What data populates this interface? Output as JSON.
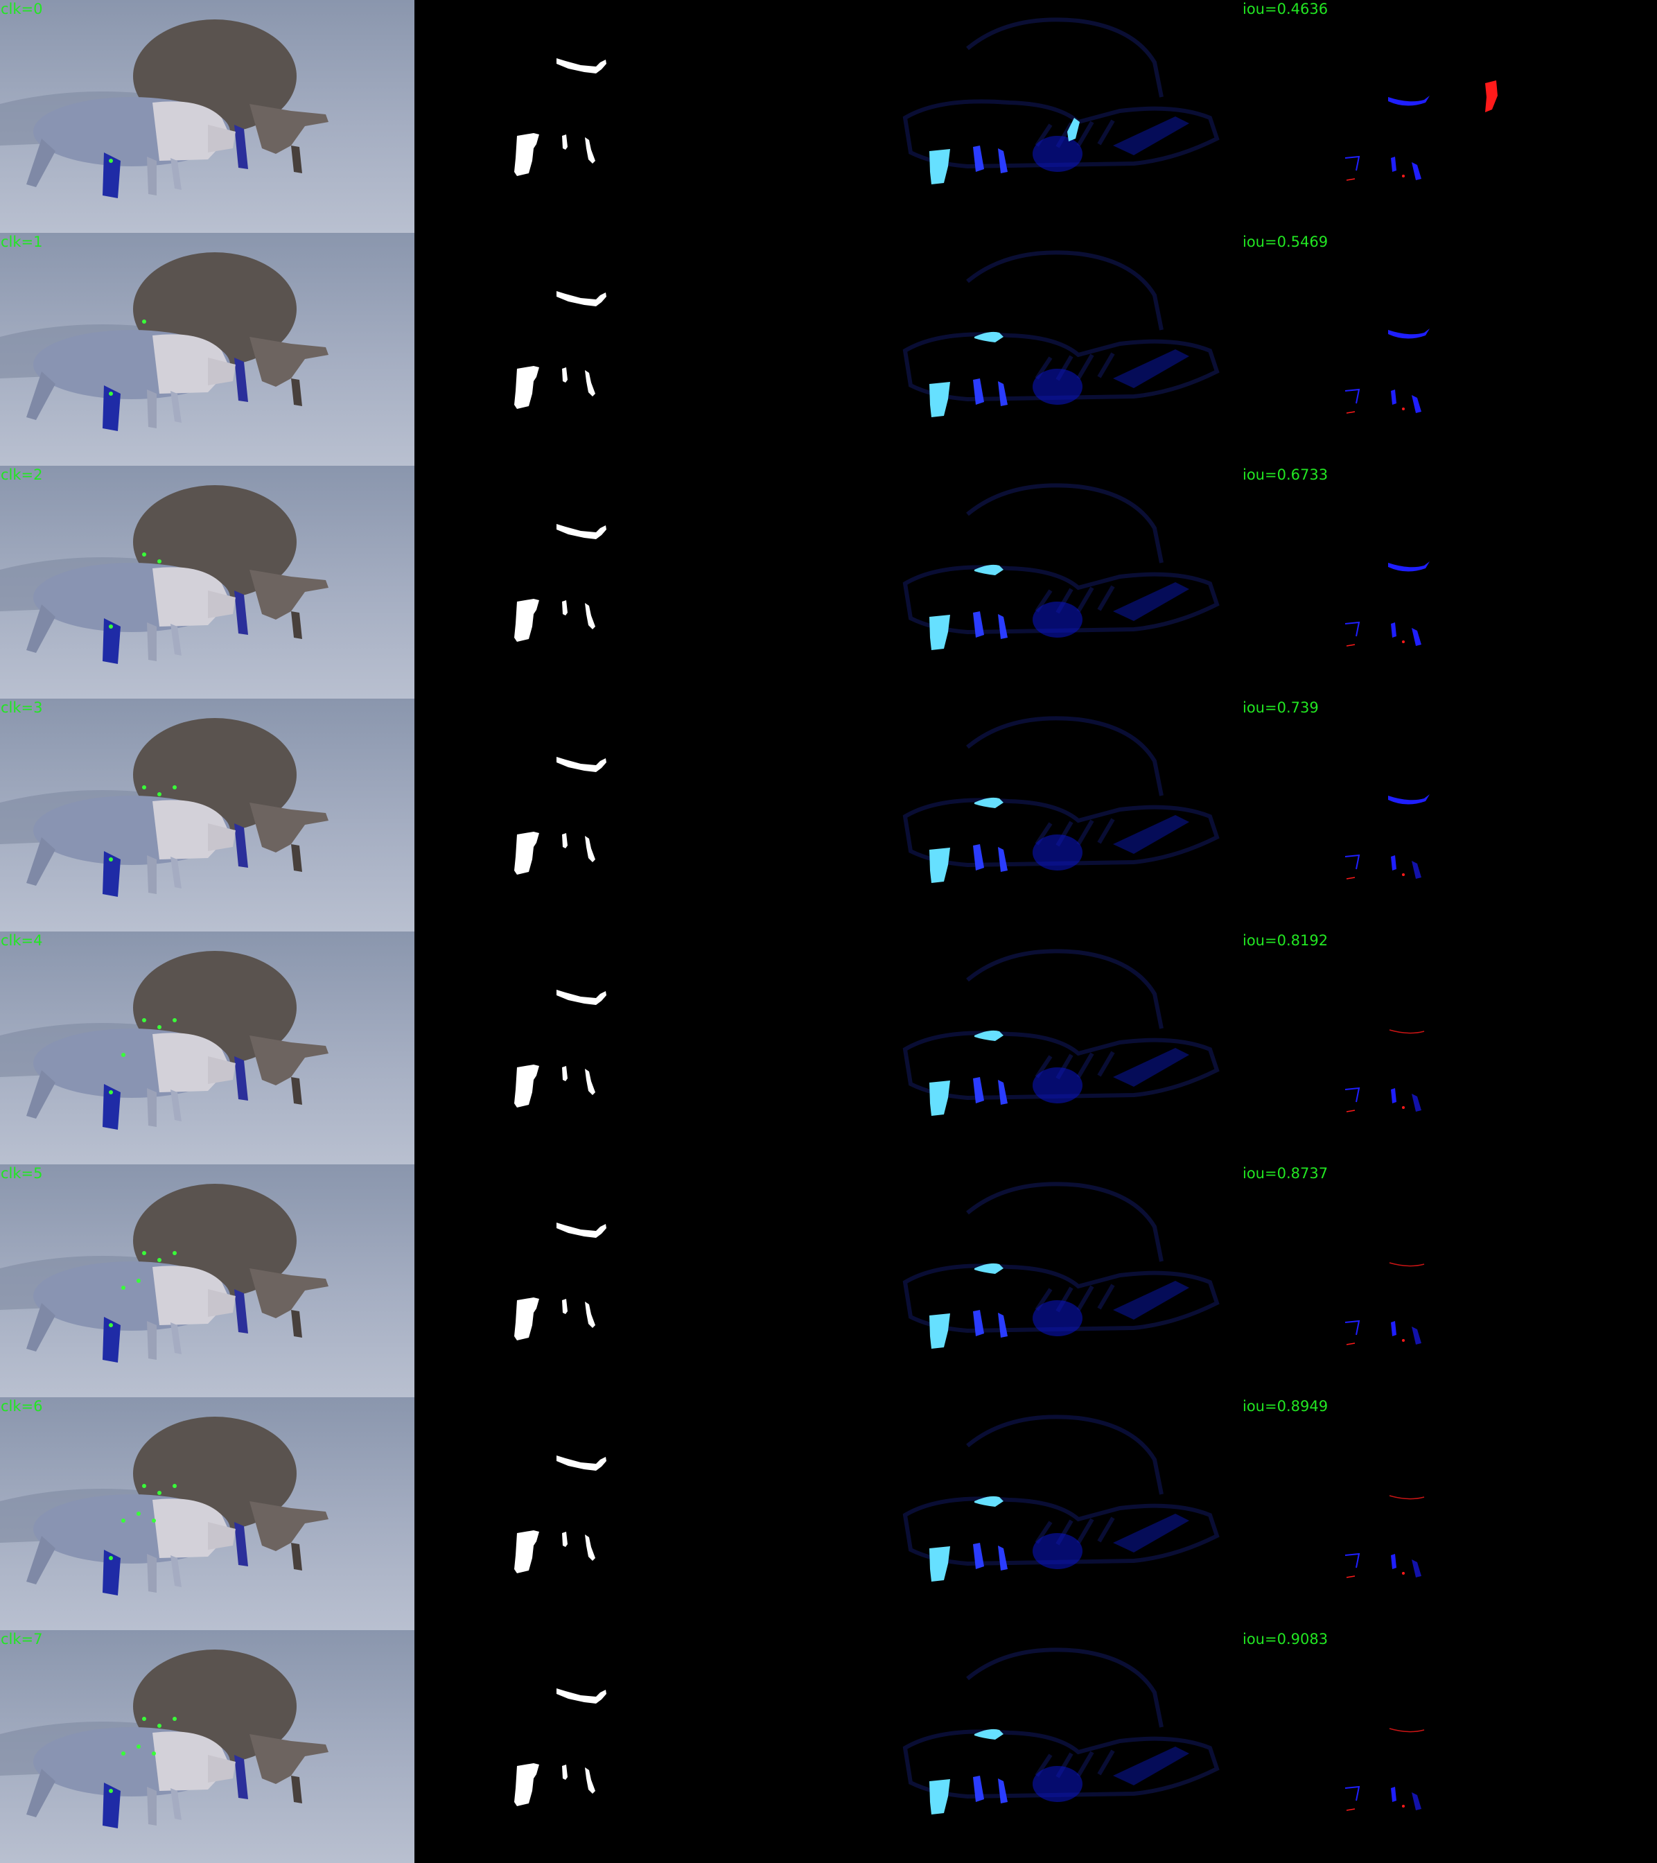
{
  "rows": [
    {
      "clk": "clk=0",
      "iou": "iou=0.4636"
    },
    {
      "clk": "clk=1",
      "iou": "iou=0.5469"
    },
    {
      "clk": "clk=2",
      "iou": "iou=0.6733"
    },
    {
      "clk": "clk=3",
      "iou": "iou=0.739"
    },
    {
      "clk": "clk=4",
      "iou": "iou=0.8192"
    },
    {
      "clk": "clk=5",
      "iou": "iou=0.8737"
    },
    {
      "clk": "clk=6",
      "iou": "iou=0.8949"
    },
    {
      "clk": "clk=7",
      "iou": "iou=0.9083"
    }
  ],
  "colors": {
    "label_text": "#22e622",
    "background": "#000000",
    "mask_fill": "#ffffff",
    "prediction_bright": "#66e0ff",
    "prediction_mid": "#1a2cff",
    "false_negative": "#1f1fff",
    "false_positive": "#ff1a1a",
    "click_point": "#39ff39"
  }
}
